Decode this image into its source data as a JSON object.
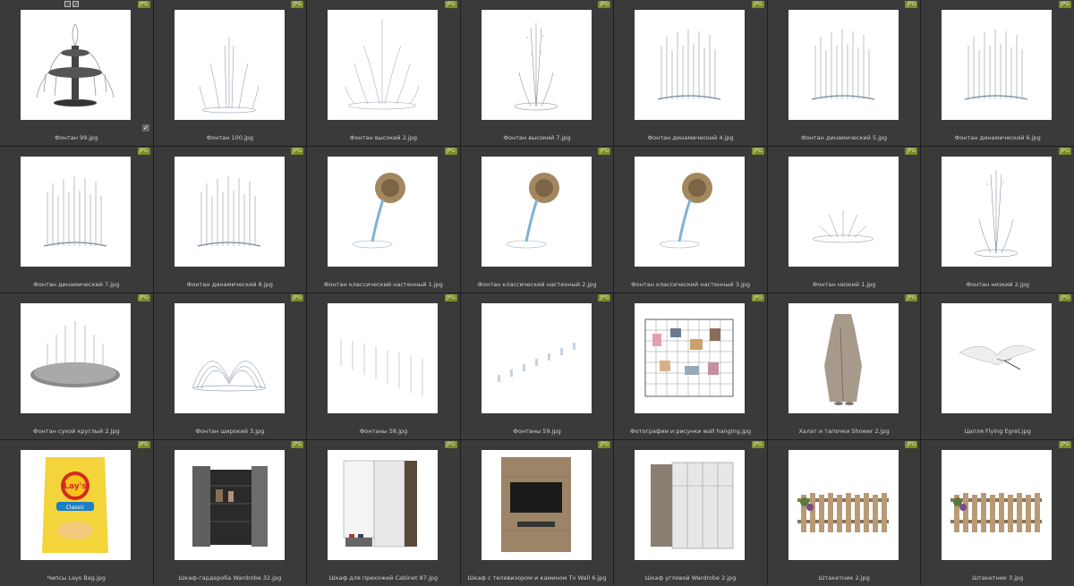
{
  "items": [
    {
      "name": "Фонтан 99.jpg",
      "badge": "JPG",
      "icon": "tiered-fountain",
      "selected": true
    },
    {
      "name": "Фонтан 100.jpg",
      "badge": "JPG",
      "icon": "jet-fountain"
    },
    {
      "name": "Фонтан высокий 2.jpg",
      "badge": "JPG",
      "icon": "tall-fountain"
    },
    {
      "name": "Фонтан высокий 7.jpg",
      "badge": "JPG",
      "icon": "spray-fountain"
    },
    {
      "name": "Фонтан динамический 4.jpg",
      "badge": "JPG",
      "icon": "curtain-fountain"
    },
    {
      "name": "Фонтан динамический 5.jpg",
      "badge": "JPG",
      "icon": "curtain-fountain"
    },
    {
      "name": "Фонтан динамический 6.jpg",
      "badge": "JPG",
      "icon": "curtain-fountain"
    },
    {
      "name": "Фонтан динамический 7.jpg",
      "badge": "JPG",
      "icon": "curtain-fountain"
    },
    {
      "name": "Фонтан динамический 8.jpg",
      "badge": "JPG",
      "icon": "curtain-fountain"
    },
    {
      "name": "Фонтан классический настенный 1.jpg",
      "badge": "JPG",
      "icon": "wall-fountain"
    },
    {
      "name": "Фонтан классический настенный 2.jpg",
      "badge": "JPG",
      "icon": "wall-fountain"
    },
    {
      "name": "Фонтан классический настенный 3.jpg",
      "badge": "JPG",
      "icon": "wall-fountain"
    },
    {
      "name": "Фонтан низкий 1.jpg",
      "badge": "JPG",
      "icon": "low-fountain"
    },
    {
      "name": "Фонтан низкий 2.jpg",
      "badge": "JPG",
      "icon": "spray-fountain"
    },
    {
      "name": "Фонтан сухой круглый 2.jpg",
      "badge": "JPG",
      "icon": "round-dry-fountain"
    },
    {
      "name": "Фонтан широкий 3.jpg",
      "badge": "JPG",
      "icon": "arc-fountain"
    },
    {
      "name": "Фонтаны 58.jpg",
      "badge": "JPG",
      "icon": "fountain-row"
    },
    {
      "name": "Фонтаны 59.jpg",
      "badge": "JPG",
      "icon": "fountain-jets"
    },
    {
      "name": "Фотографии и рисунки wall hanging.jpg",
      "badge": "JPG",
      "icon": "wall-grid"
    },
    {
      "name": "Халат и тапочки Shower 2.jpg",
      "badge": "JPG",
      "icon": "robe"
    },
    {
      "name": "Цапля Flying Egret.jpg",
      "badge": "JPG",
      "icon": "egret"
    },
    {
      "name": "Чипсы Lays Bag.jpg",
      "badge": "JPG",
      "icon": "chips-bag"
    },
    {
      "name": "Шкаф-гардероба Wardrobe 32.jpg",
      "badge": "JPG",
      "icon": "wardrobe"
    },
    {
      "name": "Шкаф для прихожей Cabinet 87.jpg",
      "badge": "JPG",
      "icon": "cabinet"
    },
    {
      "name": "Шкаф с телевизором и камином Tv Wall 6.jpg",
      "badge": "JPG",
      "icon": "tv-wall"
    },
    {
      "name": "Шкаф угловой Wardrobe 2.jpg",
      "badge": "JPG",
      "icon": "corner-wardrobe"
    },
    {
      "name": "Штакетник 2.jpg",
      "badge": "JPG",
      "icon": "fence"
    },
    {
      "name": "Штакетник 3.jpg",
      "badge": "JPG",
      "icon": "fence"
    }
  ],
  "chips_text": "Lay's",
  "chips_sub": "Classic"
}
